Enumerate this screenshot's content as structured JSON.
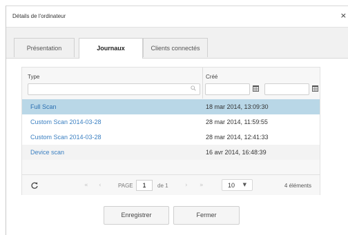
{
  "dialog": {
    "title": "Détails de l'ordinateur",
    "close_glyph": "×"
  },
  "tabs": [
    {
      "label": "Présentation",
      "active": false
    },
    {
      "label": "Journaux",
      "active": true
    },
    {
      "label": "Clients connectés",
      "active": false
    }
  ],
  "grid": {
    "columns": {
      "type": "Type",
      "created": "Créé"
    },
    "filters": {
      "type_value": "",
      "date_from": "",
      "date_to": ""
    },
    "rows": [
      {
        "type": "Full Scan",
        "created": "18 mar 2014, 13:09:30",
        "selected": true
      },
      {
        "type": "Custom Scan 2014-03-28",
        "created": "28 mar 2014, 11:59:55",
        "selected": false
      },
      {
        "type": "Custom Scan 2014-03-28",
        "created": "28 mar 2014, 12:41:33",
        "selected": false
      },
      {
        "type": "Device scan",
        "created": "16 avr 2014, 16:48:39",
        "selected": false
      }
    ],
    "pager": {
      "page_label": "PAGE",
      "page_value": "1",
      "of_label": "de 1",
      "page_size": "10",
      "count_label": "4 éléments"
    }
  },
  "buttons": {
    "save": "Enregistrer",
    "close": "Fermer"
  },
  "colors": {
    "selected_row": "#b9d7e7",
    "link_text": "#3a7fc1"
  }
}
